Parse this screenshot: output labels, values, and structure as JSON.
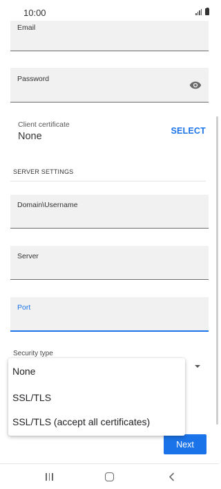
{
  "status_bar": {
    "time": "10:00"
  },
  "form": {
    "email": {
      "label": "Email",
      "value": ""
    },
    "password": {
      "label": "Password",
      "value": ""
    },
    "client_certificate": {
      "label": "Client certificate",
      "value": "None",
      "action": "SELECT"
    },
    "server_settings_header": "SERVER SETTINGS",
    "domain_username": {
      "label": "Domain\\Username",
      "value": ""
    },
    "server": {
      "label": "Server",
      "value": ""
    },
    "port": {
      "label": "Port",
      "value": ""
    },
    "security_type": {
      "label": "Security type",
      "options": [
        "None",
        "SSL/TLS",
        "SSL/TLS (accept all certificates)"
      ]
    },
    "next_label": "Next"
  },
  "colors": {
    "accent": "#1a73e8",
    "field_background": "#f1f1f1"
  },
  "icons": {
    "password_toggle": "eye-icon",
    "nav_recents": "recents-icon",
    "nav_home": "home-icon",
    "nav_back": "back-icon"
  }
}
